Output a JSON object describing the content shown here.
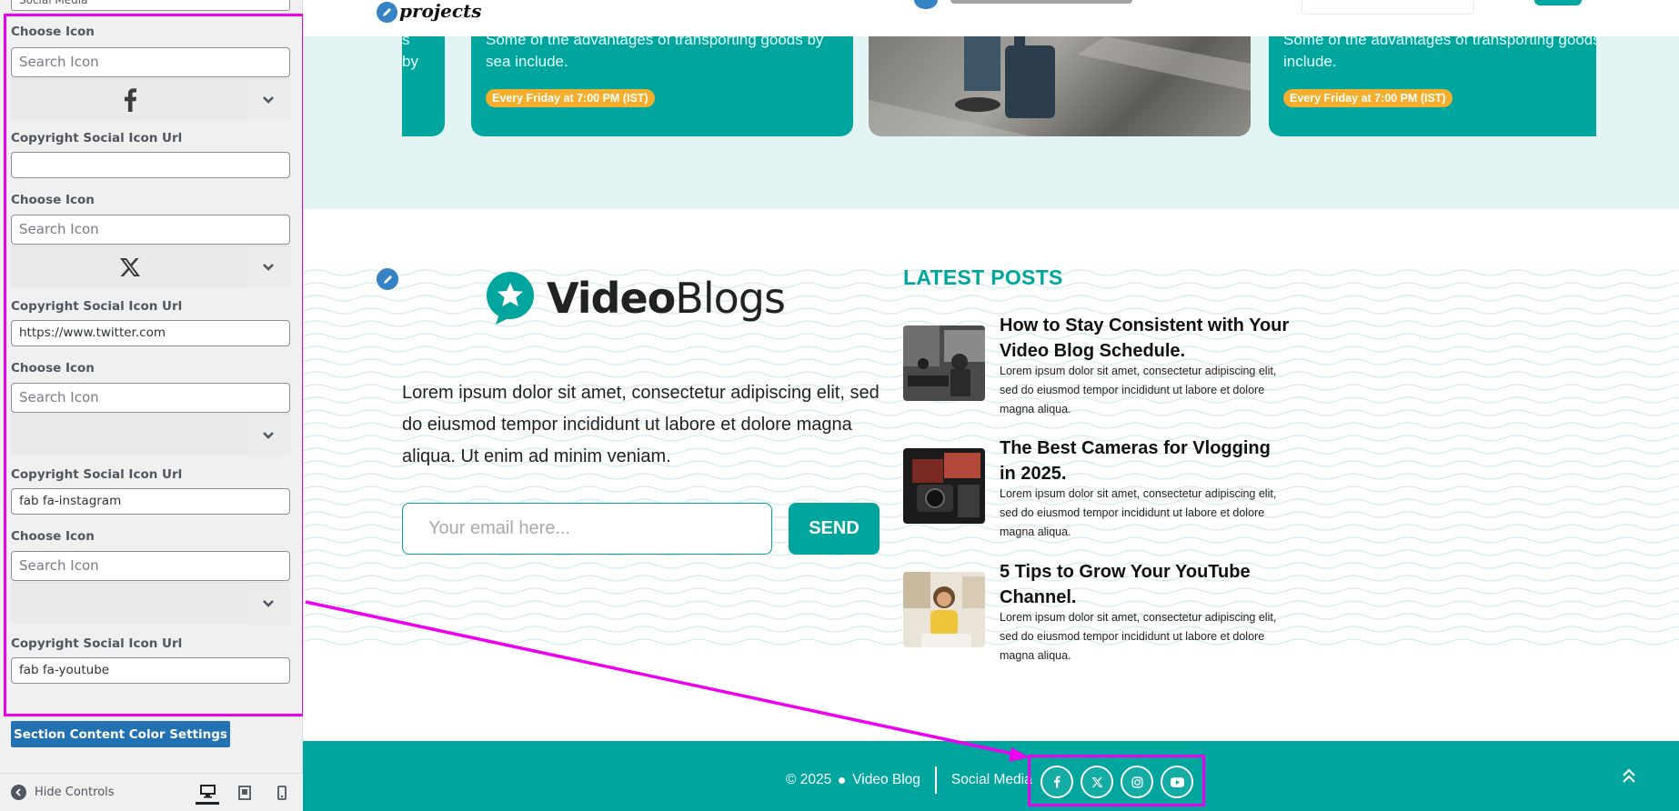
{
  "panel": {
    "top_field_value": "Social Media",
    "controls": [
      {
        "choose_label": "Choose Icon",
        "search_placeholder": "Search Icon",
        "icon": "facebook-icon",
        "url_label": "Copyright Social Icon Url",
        "url_value": ""
      },
      {
        "choose_label": "Choose Icon",
        "search_placeholder": "Search Icon",
        "icon": "x-twitter-icon",
        "url_label": "Copyright Social Icon Url",
        "url_value": "https://www.twitter.com"
      },
      {
        "choose_label": "Choose Icon",
        "search_placeholder": "Search Icon",
        "icon": "",
        "url_label": "Copyright Social Icon Url",
        "url_value": "fab fa-instagram"
      },
      {
        "choose_label": "Choose Icon",
        "search_placeholder": "Search Icon",
        "icon": "",
        "url_label": "Copyright Social Icon Url",
        "url_value": "fab fa-youtube"
      }
    ],
    "color_settings_button": "Section Content Color Settings",
    "hide_controls": "Hide Controls"
  },
  "header": {
    "logo_text": "projects"
  },
  "events": {
    "desc": "Some of the advantages of transporting goods by sea include.",
    "partial_text": "s by",
    "time_pill": "Every Friday at 7:00 PM (IST)"
  },
  "footer_widgets": {
    "logo_bold": "Video",
    "logo_regular": "Blogs",
    "about": "Lorem ipsum dolor sit amet, consectetur adipiscing elit, sed do eiusmod tempor incididunt ut labore et dolore magna aliqua. Ut enim ad minim veniam.",
    "email_placeholder": "Your email here...",
    "send_label": "SEND",
    "latest_heading": "LATEST POSTS",
    "posts": [
      {
        "title": "How to Stay Consistent with Your Video Blog Schedule.",
        "desc": "Lorem ipsum dolor sit amet, consectetur adipiscing elit, sed do eiusmod tempor incididunt ut labore et dolore magna aliqua."
      },
      {
        "title": "The Best Cameras for Vlogging in 2025.",
        "desc": "Lorem ipsum dolor sit amet, consectetur adipiscing elit, sed do eiusmod tempor incididunt ut labore et dolore magna aliqua."
      },
      {
        "title": "5 Tips to Grow Your YouTube Channel.",
        "desc": "Lorem ipsum dolor sit amet, consectetur adipiscing elit, sed do eiusmod tempor incididunt ut labore et dolore magna aliqua."
      }
    ]
  },
  "footer_bar": {
    "year": "© 2025",
    "site_name": "Video Blog",
    "social_label": "Social Media",
    "social_icons": [
      "facebook-icon",
      "x-twitter-icon",
      "instagram-icon",
      "youtube-icon"
    ]
  },
  "colors": {
    "teal": "#00a59e",
    "highlight": "#ee00ee",
    "wp_blue": "#2271b1",
    "pill": "#f2ae2c"
  }
}
